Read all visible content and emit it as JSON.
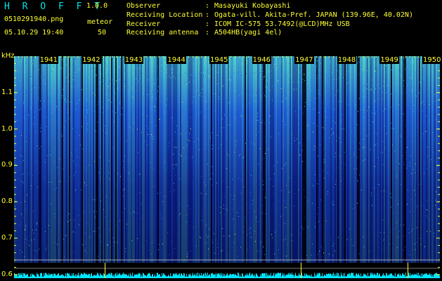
{
  "header": {
    "app_title": "H R O F F T",
    "version": "1.0.0",
    "filename": "0510291940.png",
    "datetime": "05.10.29 19:40",
    "meteor_label": "meteor",
    "meteor_count": "50",
    "info": [
      {
        "label": "Observer",
        "value": "Masayuki Kobayashi"
      },
      {
        "label": "Receiving Location",
        "value": "Ogata-vill. Akita-Pref. JAPAN (139.96E, 40.02N)"
      },
      {
        "label": "Receiver",
        "value": "ICOM IC-575 53.7492(@LCD)MHz USB"
      },
      {
        "label": "Receiving antenna",
        "value": "A504HB(yagi 4el)"
      }
    ],
    "separator": ":"
  },
  "chart_data": {
    "type": "heatmap",
    "ylabel": "kHz",
    "y_ticks": [
      "1.1",
      "1.0",
      "0.9",
      "0.8",
      "0.7",
      "0.6"
    ],
    "x_ticks": [
      "1941",
      "1942",
      "1943",
      "1944",
      "1945",
      "1946",
      "1947",
      "1948",
      "1949",
      "1950"
    ],
    "ylim": [
      0.59,
      1.2
    ],
    "xlim": [
      "19:40",
      "19:50"
    ],
    "colors": {
      "background": "#000000",
      "low": "#0a1a7a",
      "mid": "#1e5ad0",
      "high": "#4fd2c8",
      "peak": "#c8ff50",
      "ticks": "#ffff33",
      "hline": "#cccccc",
      "baseline": "#00e5ff"
    }
  }
}
